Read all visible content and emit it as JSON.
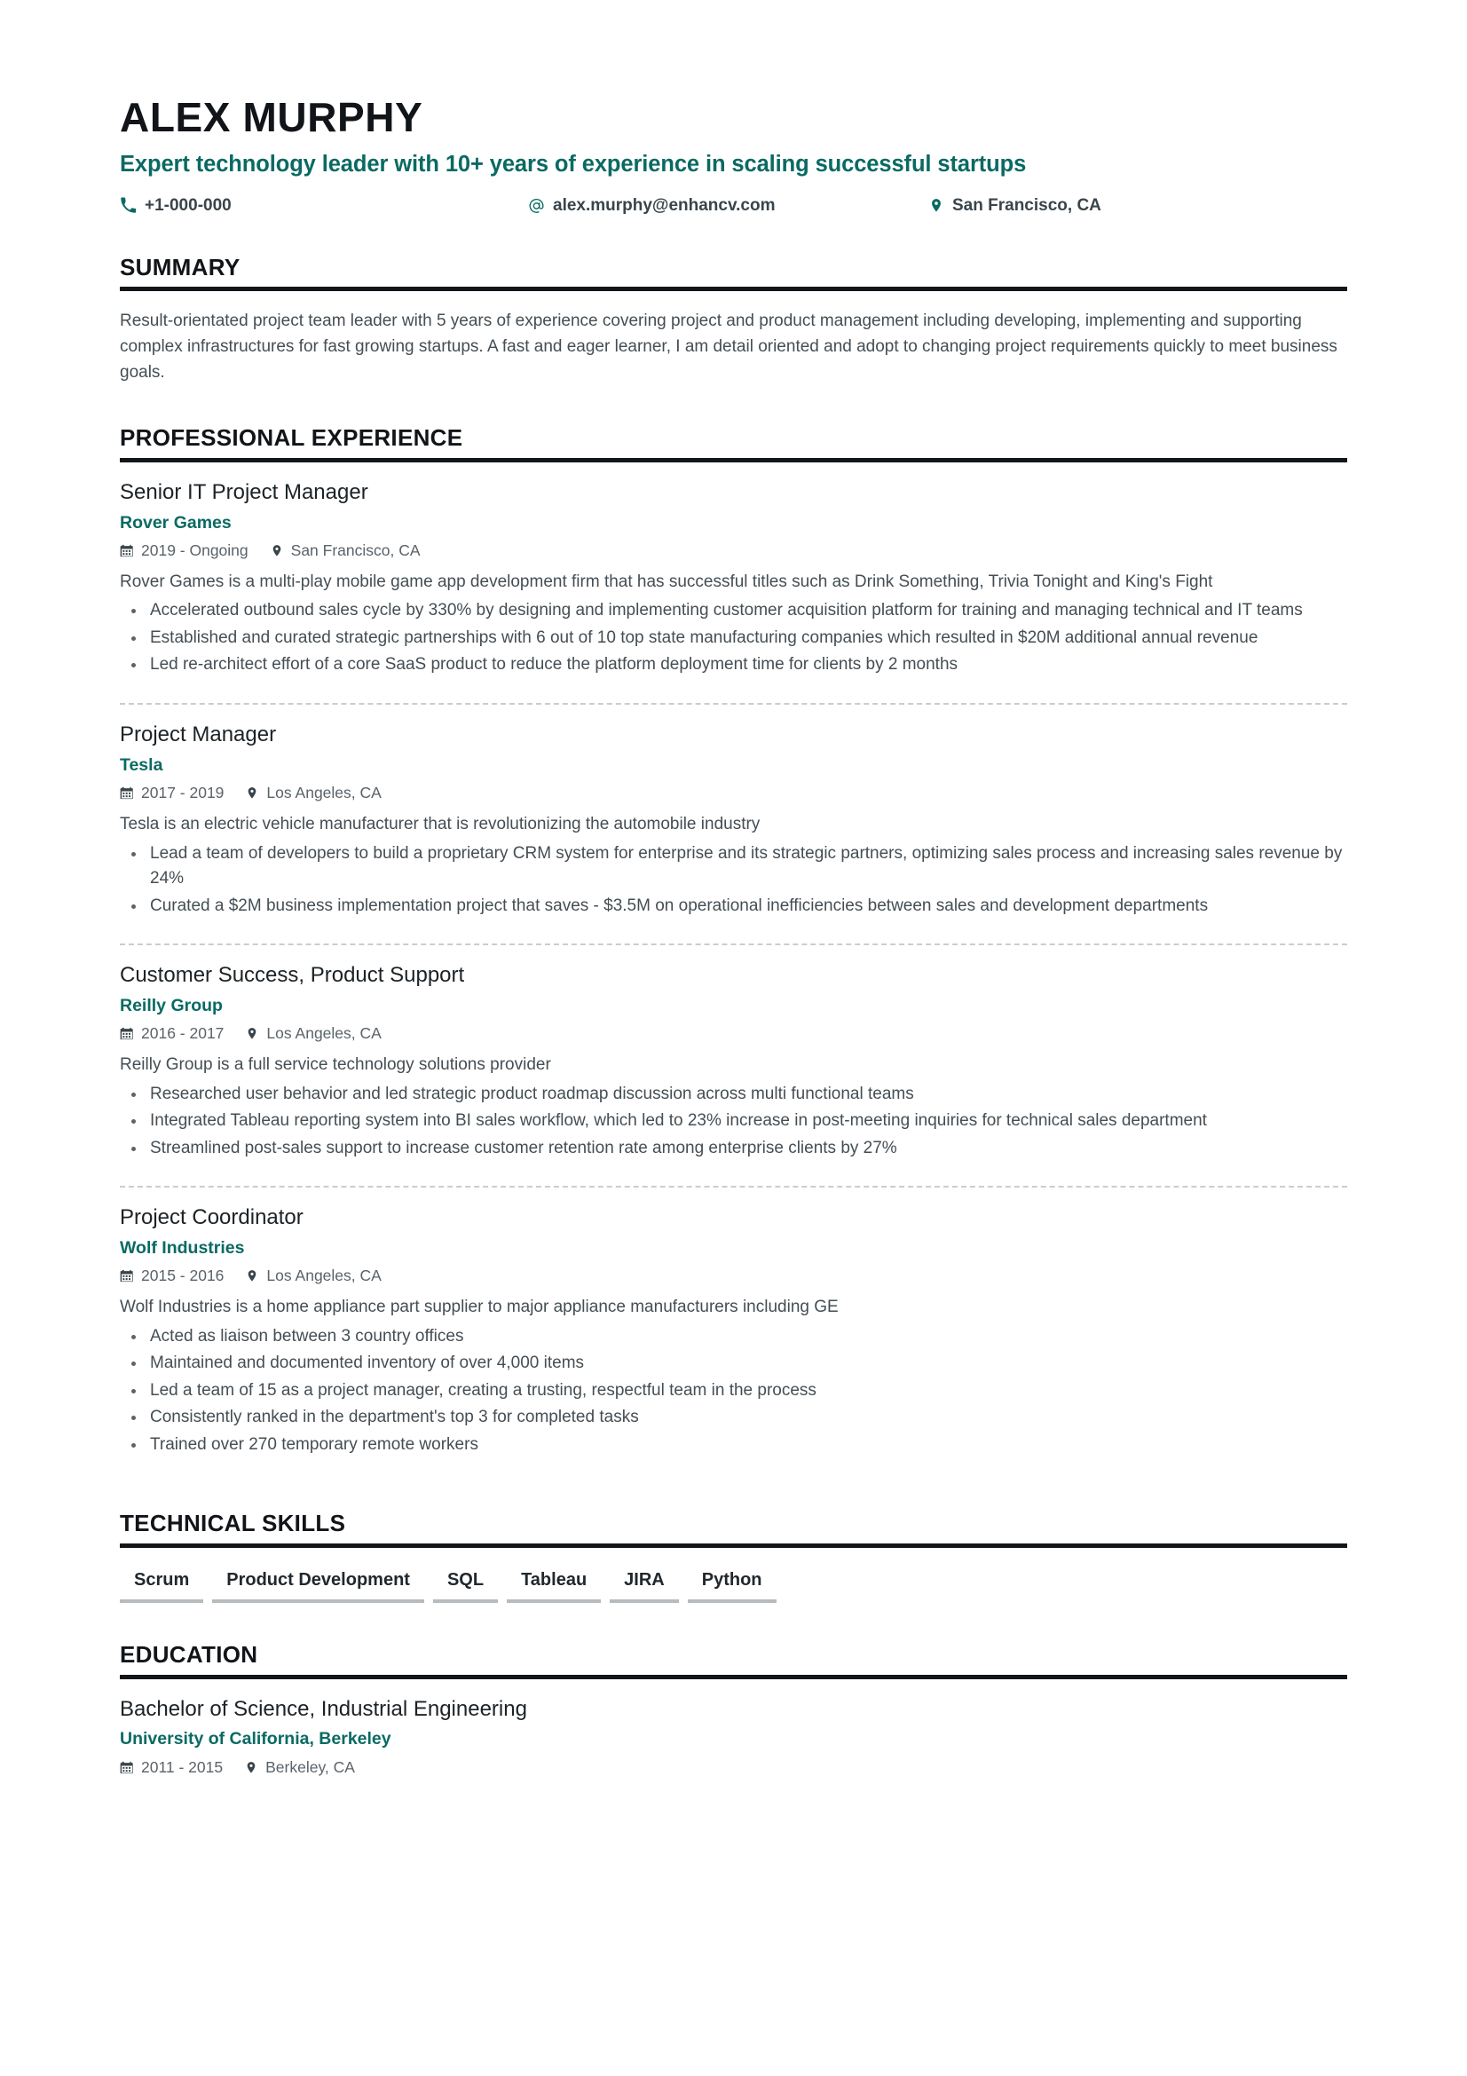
{
  "theme": {
    "accent": "#0a6a63",
    "rule": "#121619",
    "text": "#444e54"
  },
  "header": {
    "name": "ALEX MURPHY",
    "headline": "Expert technology leader with 10+ years of experience in scaling successful startups",
    "contacts": [
      {
        "icon": "phone-icon",
        "value": "+1-000-000"
      },
      {
        "icon": "at-icon",
        "value": "alex.murphy@enhancv.com"
      },
      {
        "icon": "location-pin-icon",
        "value": "San Francisco, CA"
      }
    ]
  },
  "summary": {
    "title": "SUMMARY",
    "text": "Result-orientated project team leader with 5 years of experience covering project and product management including developing, implementing and supporting complex infrastructures for fast growing startups. A fast and eager learner, I am detail oriented and adopt to changing project requirements quickly to meet business goals."
  },
  "experience": {
    "title": "PROFESSIONAL EXPERIENCE",
    "entries": [
      {
        "job_title": "Senior IT Project Manager",
        "company": "Rover Games",
        "dates": "2019 - Ongoing",
        "location": "San Francisco, CA",
        "description": "Rover Games is a multi-play mobile game app development firm that has successful titles such as Drink Something, Trivia Tonight and King's Fight",
        "bullets": [
          "Accelerated outbound sales cycle by 330% by designing and implementing customer acquisition platform for training and managing technical and IT teams",
          "Established and curated strategic partnerships with 6 out of 10 top state manufacturing companies which resulted in $20M additional annual revenue",
          "Led re-architect effort of a core SaaS product to reduce the platform deployment time for clients by 2 months"
        ]
      },
      {
        "job_title": "Project Manager",
        "company": "Tesla",
        "dates": "2017 - 2019",
        "location": "Los Angeles, CA",
        "description": "Tesla is an electric vehicle manufacturer that is revolutionizing the automobile industry",
        "bullets": [
          "Lead a team of developers to build a proprietary CRM system for enterprise and its strategic partners, optimizing sales process and increasing sales revenue by 24%",
          "Curated a $2M business implementation project that saves - $3.5M on operational inefficiencies between sales and development departments"
        ]
      },
      {
        "job_title": "Customer Success, Product Support",
        "company": "Reilly Group",
        "dates": "2016 - 2017",
        "location": "Los Angeles, CA",
        "description": "Reilly Group is a full service technology solutions provider",
        "bullets": [
          "Researched user behavior and led strategic product roadmap discussion across multi functional teams",
          "Integrated Tableau reporting system into BI sales workflow, which led to 23% increase in post-meeting inquiries for technical sales department",
          "Streamlined post-sales support to increase customer retention rate among enterprise clients by 27%"
        ]
      },
      {
        "job_title": "Project Coordinator",
        "company": "Wolf Industries",
        "dates": "2015 - 2016",
        "location": "Los Angeles, CA",
        "description": "Wolf Industries is a home appliance part supplier to major appliance manufacturers including GE",
        "bullets": [
          "Acted as liaison between 3 country offices",
          "Maintained and documented inventory of over 4,000 items",
          "Led a team of 15 as a project manager, creating a trusting, respectful team in the process",
          "Consistently ranked in the department's top 3 for completed tasks",
          "Trained over 270 temporary remote workers"
        ]
      }
    ]
  },
  "skills": {
    "title": "TECHNICAL SKILLS",
    "items": [
      "Scrum",
      "Product Development",
      "SQL",
      "Tableau",
      "JIRA",
      "Python"
    ]
  },
  "education": {
    "title": "EDUCATION",
    "entries": [
      {
        "degree": "Bachelor of Science, Industrial Engineering",
        "school": "University of California, Berkeley",
        "dates": "2011 - 2015",
        "location": "Berkeley, CA"
      }
    ]
  }
}
